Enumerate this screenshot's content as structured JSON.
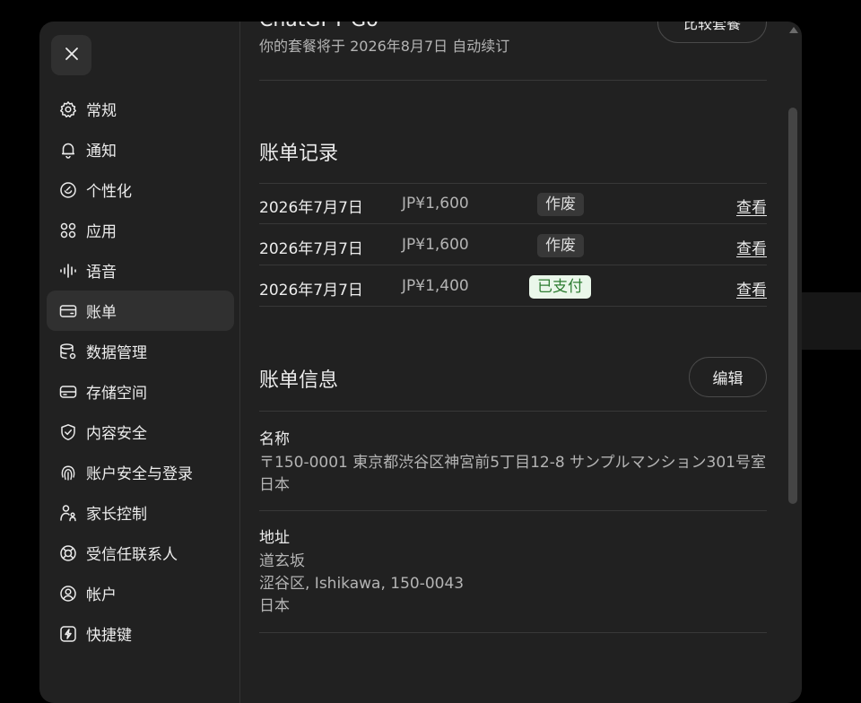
{
  "window": {
    "close_icon": "close-icon"
  },
  "sidebar": {
    "items": [
      {
        "label": "常规",
        "icon": "gear-icon"
      },
      {
        "label": "通知",
        "icon": "bell-icon"
      },
      {
        "label": "个性化",
        "icon": "smile-icon"
      },
      {
        "label": "应用",
        "icon": "apps-grid-icon"
      },
      {
        "label": "语音",
        "icon": "waveform-icon"
      },
      {
        "label": "账单",
        "icon": "card-icon",
        "active": true
      },
      {
        "label": "数据管理",
        "icon": "database-gear-icon"
      },
      {
        "label": "存储空间",
        "icon": "storage-icon"
      },
      {
        "label": "内容安全",
        "icon": "shield-check-icon"
      },
      {
        "label": "账户安全与登录",
        "icon": "fingerprint-icon"
      },
      {
        "label": "家长控制",
        "icon": "parent-child-icon"
      },
      {
        "label": "受信任联系人",
        "icon": "lifebuoy-icon"
      },
      {
        "label": "帐户",
        "icon": "user-circle-icon"
      },
      {
        "label": "快捷键",
        "icon": "lightning-key-icon"
      }
    ]
  },
  "plan": {
    "name": "ChatGPT Go",
    "renewal_text": "你的套餐将于 2026年8月7日 自动续订",
    "compare_button": "比较套餐"
  },
  "billing_history": {
    "title": "账单记录",
    "rows": [
      {
        "date": "2026年7月7日",
        "amount": "JP¥1,600",
        "status": "作废",
        "status_type": "void",
        "action": "查看"
      },
      {
        "date": "2026年7月7日",
        "amount": "JP¥1,600",
        "status": "作废",
        "status_type": "void",
        "action": "查看"
      },
      {
        "date": "2026年7月7日",
        "amount": "JP¥1,400",
        "status": "已支付",
        "status_type": "paid",
        "action": "查看"
      }
    ]
  },
  "billing_info": {
    "title": "账单信息",
    "edit_button": "编辑",
    "name_label": "名称",
    "name_value": "〒150-0001 東京都渋谷区神宮前5丁目12-8 サンプルマンション301号室 日本",
    "address_label": "地址",
    "address_lines": [
      "道玄坂",
      "涩谷区, Ishikawa, 150-0043",
      "日本"
    ]
  },
  "colors": {
    "modal_bg": "#212121",
    "active_item_bg": "#303030",
    "paid_badge_bg": "#eaf7ea",
    "paid_badge_text": "#2e7d32",
    "void_badge_bg": "#383838"
  }
}
